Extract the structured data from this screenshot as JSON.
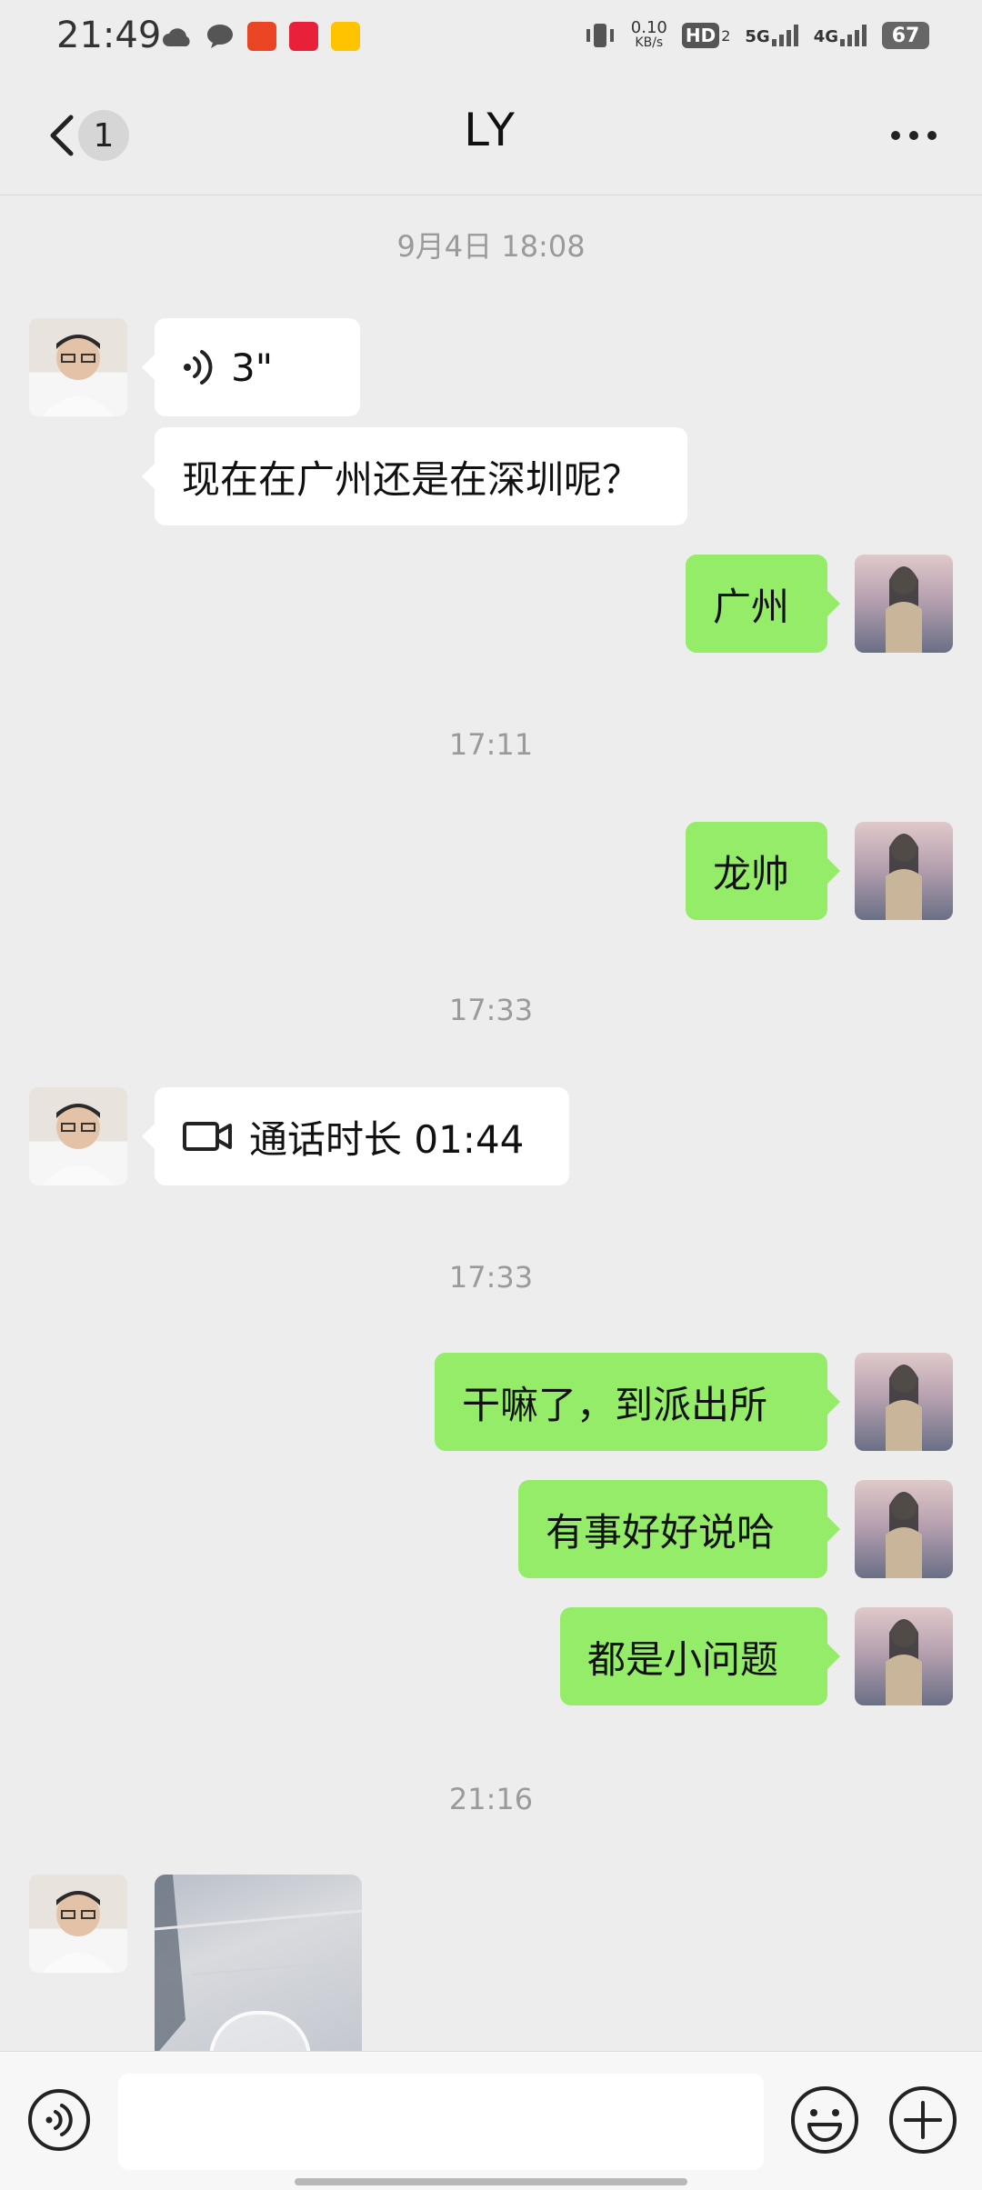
{
  "status_bar": {
    "time": "21:49",
    "net_speed": "0.10",
    "net_unit": "KB/s",
    "hd": "HD",
    "sim2": "2",
    "net1": "5G",
    "net2": "4G",
    "battery": "67",
    "icons": [
      "cloud-icon",
      "chat-bubble-icon",
      "ting-app-icon",
      "heart-app-icon",
      "meituan-app-icon",
      "vibrate-icon"
    ]
  },
  "header": {
    "title": "LY",
    "unread_count": "1"
  },
  "messages": [
    {
      "type": "timestamp",
      "text": "9月4日 18:08"
    },
    {
      "type": "voice",
      "from": "contact",
      "duration": "3\""
    },
    {
      "type": "text",
      "from": "contact",
      "text": "现在在广州还是在深圳呢？"
    },
    {
      "type": "text",
      "from": "me",
      "text": "广州"
    },
    {
      "type": "timestamp",
      "text": "17:11"
    },
    {
      "type": "text",
      "from": "me",
      "text": "龙帅"
    },
    {
      "type": "timestamp",
      "text": "17:33"
    },
    {
      "type": "call",
      "from": "contact",
      "text": "通话时长 01:44"
    },
    {
      "type": "timestamp",
      "text": "17:33"
    },
    {
      "type": "text",
      "from": "me",
      "text": "干嘛了，到派出所"
    },
    {
      "type": "text",
      "from": "me",
      "text": "有事好好说哈"
    },
    {
      "type": "text",
      "from": "me",
      "text": "都是小问题"
    },
    {
      "type": "timestamp",
      "text": "21:16"
    },
    {
      "type": "video",
      "from": "contact"
    }
  ],
  "colors": {
    "background": "#ededed",
    "outgoing_bubble": "#95ec69",
    "incoming_bubble": "#ffffff",
    "timestamp": "#9a9a9a"
  }
}
